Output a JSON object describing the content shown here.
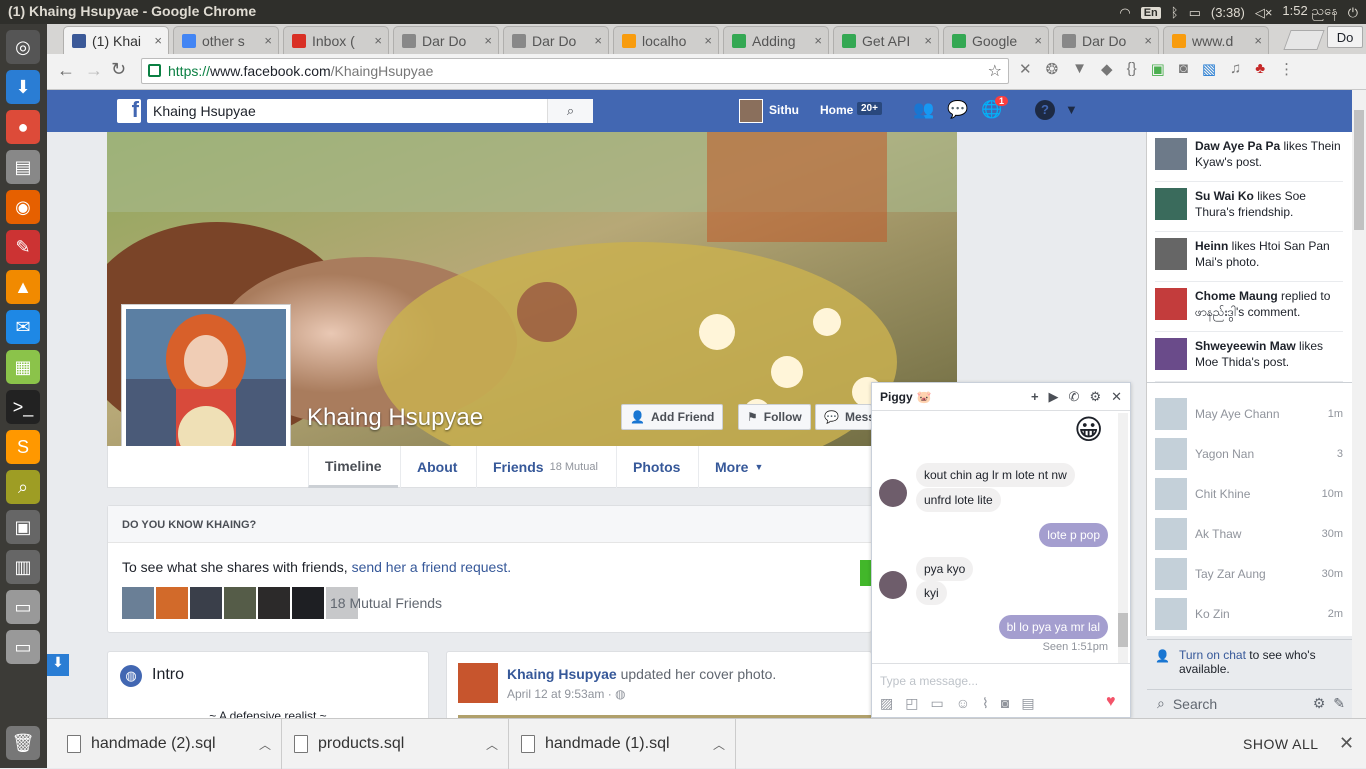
{
  "os": {
    "window_title": "(1) Khaing Hsupyae - Google Chrome",
    "keyboard": "En",
    "battery": "(3:38)",
    "clock": "1:52 ညနေ"
  },
  "tabs": [
    {
      "label": "(1) Khai",
      "favicon": "facebook-icon",
      "color": "#3b5998"
    },
    {
      "label": "other s",
      "favicon": "google-icon",
      "color": "#4285f4"
    },
    {
      "label": "Inbox (",
      "favicon": "gmail-icon",
      "color": "#d93025"
    },
    {
      "label": "Dar Do",
      "favicon": "doc-icon",
      "color": "#888"
    },
    {
      "label": "Dar Do",
      "favicon": "doc-icon",
      "color": "#888"
    },
    {
      "label": "localho",
      "favicon": "pma-icon",
      "color": "#f89c0e"
    },
    {
      "label": "Adding",
      "favicon": "codeigniter-icon",
      "color": "#34a853"
    },
    {
      "label": "Get API",
      "favicon": "codeigniter-icon",
      "color": "#34a853"
    },
    {
      "label": "Google",
      "favicon": "maps-icon",
      "color": "#34a853"
    },
    {
      "label": "Dar Do",
      "favicon": "doc-icon",
      "color": "#888"
    },
    {
      "label": "www.d",
      "favicon": "pma-icon",
      "color": "#f89c0e"
    }
  ],
  "profile_button": "Do",
  "omnibox": {
    "scheme": "https://",
    "domain": "www.facebook.com",
    "path": "/KhaingHsupyae"
  },
  "fb": {
    "search_value": "Khaing Hsupyae",
    "user": "Sithu",
    "home": "Home",
    "home_badge": "20+",
    "notif_badge": "1"
  },
  "profile": {
    "name": "Khaing Hsupyae",
    "add_friend": "Add Friend",
    "follow": "Follow",
    "message": "Mess",
    "tabs": {
      "timeline": "Timeline",
      "about": "About",
      "friends": "Friends",
      "mutual": "18 Mutual",
      "photos": "Photos",
      "more": "More"
    }
  },
  "know": {
    "heading": "DO YOU KNOW KHAING?",
    "text": "To see what she shares with friends, ",
    "link": "send her a friend request.",
    "mutual": "18 Mutual Friends"
  },
  "intro": {
    "title": "Intro",
    "bio": "~ A defensive realist ~"
  },
  "post": {
    "author": "Khaing Hsupyae",
    "action": " updated her cover photo.",
    "time": "April 12 at 9:53am · "
  },
  "ticker": [
    {
      "name": "Daw Aye Pa Pa",
      "rest": " likes Thein Kyaw's post."
    },
    {
      "name": "Su Wai Ko",
      "rest": " likes Soe Thura's friendship."
    },
    {
      "name": "Heinn",
      "rest": " likes Htoi San Pan Mai's photo."
    },
    {
      "name": "Chome Maung",
      "rest": " replied to ဖာနည်းဒွါ's comment."
    },
    {
      "name": "Shweyeewin Maw",
      "rest": " likes Moe Thida's post."
    }
  ],
  "chat_users": [
    {
      "name": "May Aye Chann",
      "time": "1m"
    },
    {
      "name": "Yagon Nan",
      "time": "3"
    },
    {
      "name": "Chit Khine",
      "time": "10m"
    },
    {
      "name": "Ak Thaw",
      "time": "30m"
    },
    {
      "name": "Tay Zar Aung",
      "time": "30m"
    },
    {
      "name": "Ko Zin",
      "time": "2m"
    }
  ],
  "chat_footer": {
    "link": "Turn on chat",
    "rest": " to see who's available.",
    "search": "Search"
  },
  "chatwin": {
    "title": "Piggy",
    "messages": [
      {
        "text": "kout chin ag lr m lote nt nw",
        "me": false
      },
      {
        "text": "unfrd lote lite",
        "me": false
      },
      {
        "text": "lote p pop",
        "me": true
      },
      {
        "text": "pya kyo",
        "me": false
      },
      {
        "text": "kyi",
        "me": false
      },
      {
        "text": "bl lo pya ya mr lal",
        "me": true
      }
    ],
    "seen": "Seen 1:51pm",
    "placeholder": "Type a message..."
  },
  "downloads": {
    "files": [
      "handmade (2).sql",
      "products.sql",
      "handmade (1).sql"
    ],
    "show_all": "SHOW ALL"
  }
}
